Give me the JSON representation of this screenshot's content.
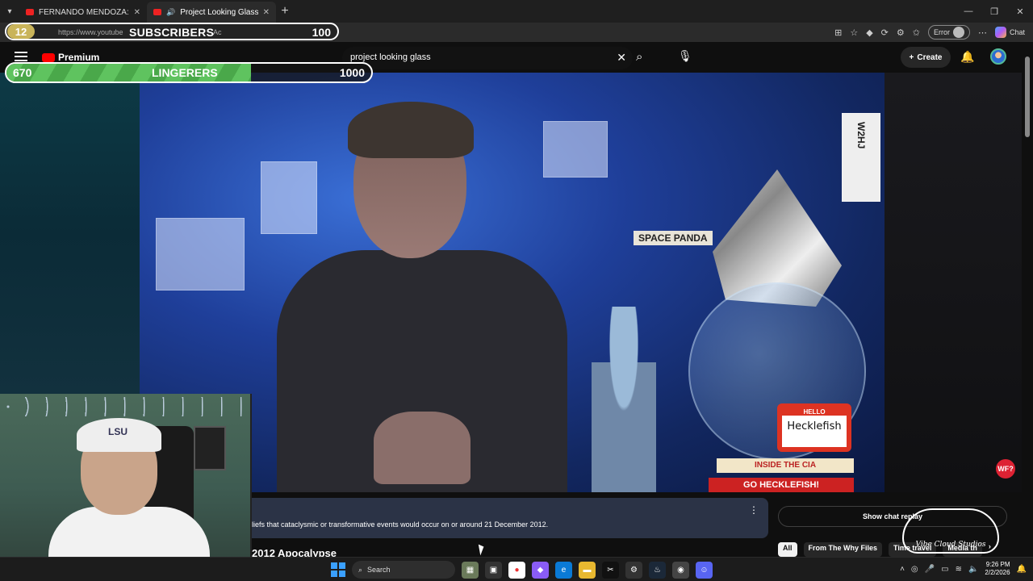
{
  "browser": {
    "tabs": [
      {
        "label": "FERNANDO MENDOZA: Sundae C",
        "active": false
      },
      {
        "label": "Project Looking Glass | The Tr",
        "active": true
      }
    ],
    "url": "https://www.youtube",
    "url_tail": "Ac",
    "error_label": "Error",
    "chat_label": "Chat"
  },
  "overlay": {
    "subscribers": {
      "count": "12",
      "label": "SUBSCRIBERS",
      "goal": "100"
    },
    "lingerers": {
      "count": "670",
      "label": "LINGERERS",
      "goal": "1000",
      "progress": 0.67
    }
  },
  "youtube": {
    "logo": "Premium",
    "search_query": "project looking glass",
    "create_label": "Create",
    "description": "liefs that cataclysmic or transformative events would occur on or around 21 December 2012.",
    "next_title": "2012 Apocalypse",
    "show_chat_replay": "Show chat replay",
    "chips": [
      "All",
      "From The Why Files",
      "Time travel",
      "Media th"
    ],
    "channel_badge": "WF?"
  },
  "video_scene": {
    "poster_text": "SPACE PANDA",
    "nametag_hello": "HELLO",
    "nametag_name": "Hecklefish",
    "book_title": "INSIDE THE CIA",
    "banner_text": "GO HECKLEFISH!",
    "callsign": "W2HJ"
  },
  "webcam": {
    "cap_text": "LSU"
  },
  "watermark": "Vibe Cloud Studios",
  "taskbar": {
    "search_label": "Search",
    "time": "9:26 PM",
    "date": "2/2/2026"
  },
  "colors": {
    "accent_red": "#ff0000",
    "overlay_green": "#5fc35f",
    "sub_gold": "#c9b45a"
  }
}
